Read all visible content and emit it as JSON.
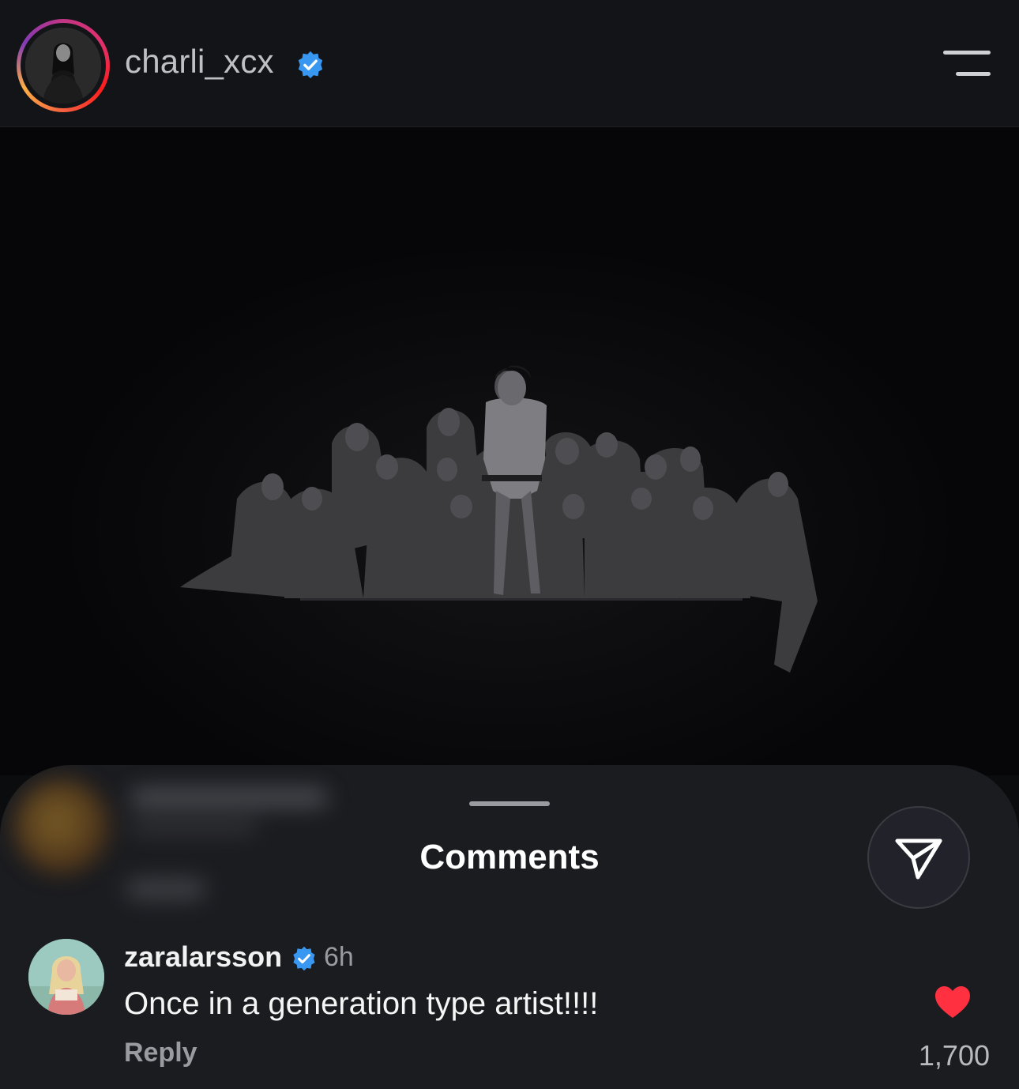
{
  "header": {
    "username": "charli_xcx",
    "verified": true,
    "menu_icon": "menu-icon"
  },
  "post": {
    "image_description_icon": "photo"
  },
  "comments_sheet": {
    "title": "Comments",
    "share_icon": "send-icon",
    "comment": {
      "username": "zaralarsson",
      "verified": true,
      "time": "6h",
      "text": "Once in a generation type artist!!!!",
      "reply_label": "Reply",
      "liked": true,
      "like_count": "1,700"
    }
  },
  "colors": {
    "background": "#0b0c0e",
    "header_bg": "#131417",
    "sheet_bg": "#1b1c20",
    "verified_blue": "#3897f0",
    "heart_red": "#ff3040"
  }
}
